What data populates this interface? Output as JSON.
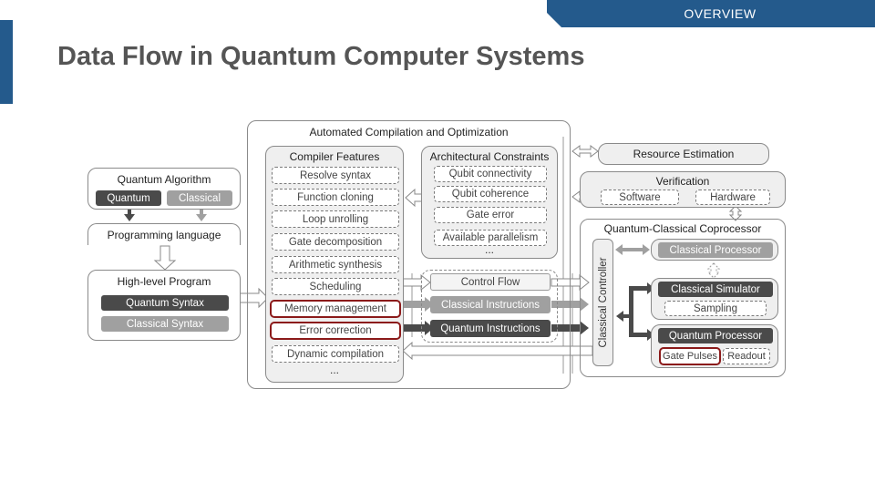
{
  "header": {
    "section_tab": "OVERVIEW",
    "title": "Data Flow in Quantum Computer Systems"
  },
  "diagram": {
    "quantum_algorithm": {
      "title": "Quantum Algorithm",
      "quantum": "Quantum",
      "classical": "Classical"
    },
    "programming_language": "Programming language",
    "high_level_program": {
      "title": "High-level Program",
      "quantum_syntax": "Quantum Syntax",
      "classical_syntax": "Classical Syntax"
    },
    "compilation": {
      "title": "Automated Compilation and Optimization",
      "compiler_features": {
        "title": "Compiler Features",
        "items": [
          {
            "label": "Resolve syntax",
            "highlighted": false
          },
          {
            "label": "Function cloning",
            "highlighted": false
          },
          {
            "label": "Loop unrolling",
            "highlighted": false
          },
          {
            "label": "Gate decomposition",
            "highlighted": false
          },
          {
            "label": "Arithmetic synthesis",
            "highlighted": false
          },
          {
            "label": "Scheduling",
            "highlighted": false
          },
          {
            "label": "Memory management",
            "highlighted": true
          },
          {
            "label": "Error correction",
            "highlighted": true
          },
          {
            "label": "Dynamic compilation",
            "highlighted": false
          }
        ],
        "ellipsis": "..."
      },
      "architectural_constraints": {
        "title": "Architectural Constraints",
        "items": [
          "Qubit connectivity",
          "Qubit coherence",
          "Gate error",
          "Available parallelism"
        ],
        "ellipsis": "..."
      },
      "outputs": {
        "control_flow": "Control Flow",
        "classical_instructions": "Classical Instructions",
        "quantum_instructions": "Quantum Instructions"
      }
    },
    "resource_estimation": "Resource Estimation",
    "verification": {
      "title": "Verification",
      "software": "Software",
      "hardware": "Hardware"
    },
    "coprocessor": {
      "title": "Quantum-Classical Coprocessor",
      "classical_controller": "Classical Controller",
      "classical_processor": "Classical Processor",
      "classical_simulator": "Classical Simulator",
      "sampling": "Sampling",
      "quantum_processor": "Quantum Processor",
      "gate_pulses": "Gate Pulses",
      "readout": "Readout"
    }
  },
  "colors": {
    "brand_blue": "#245a8c",
    "highlight_red": "#8b1a1a",
    "dark_gray": "#4a4a4a",
    "mid_gray": "#a0a0a0"
  }
}
